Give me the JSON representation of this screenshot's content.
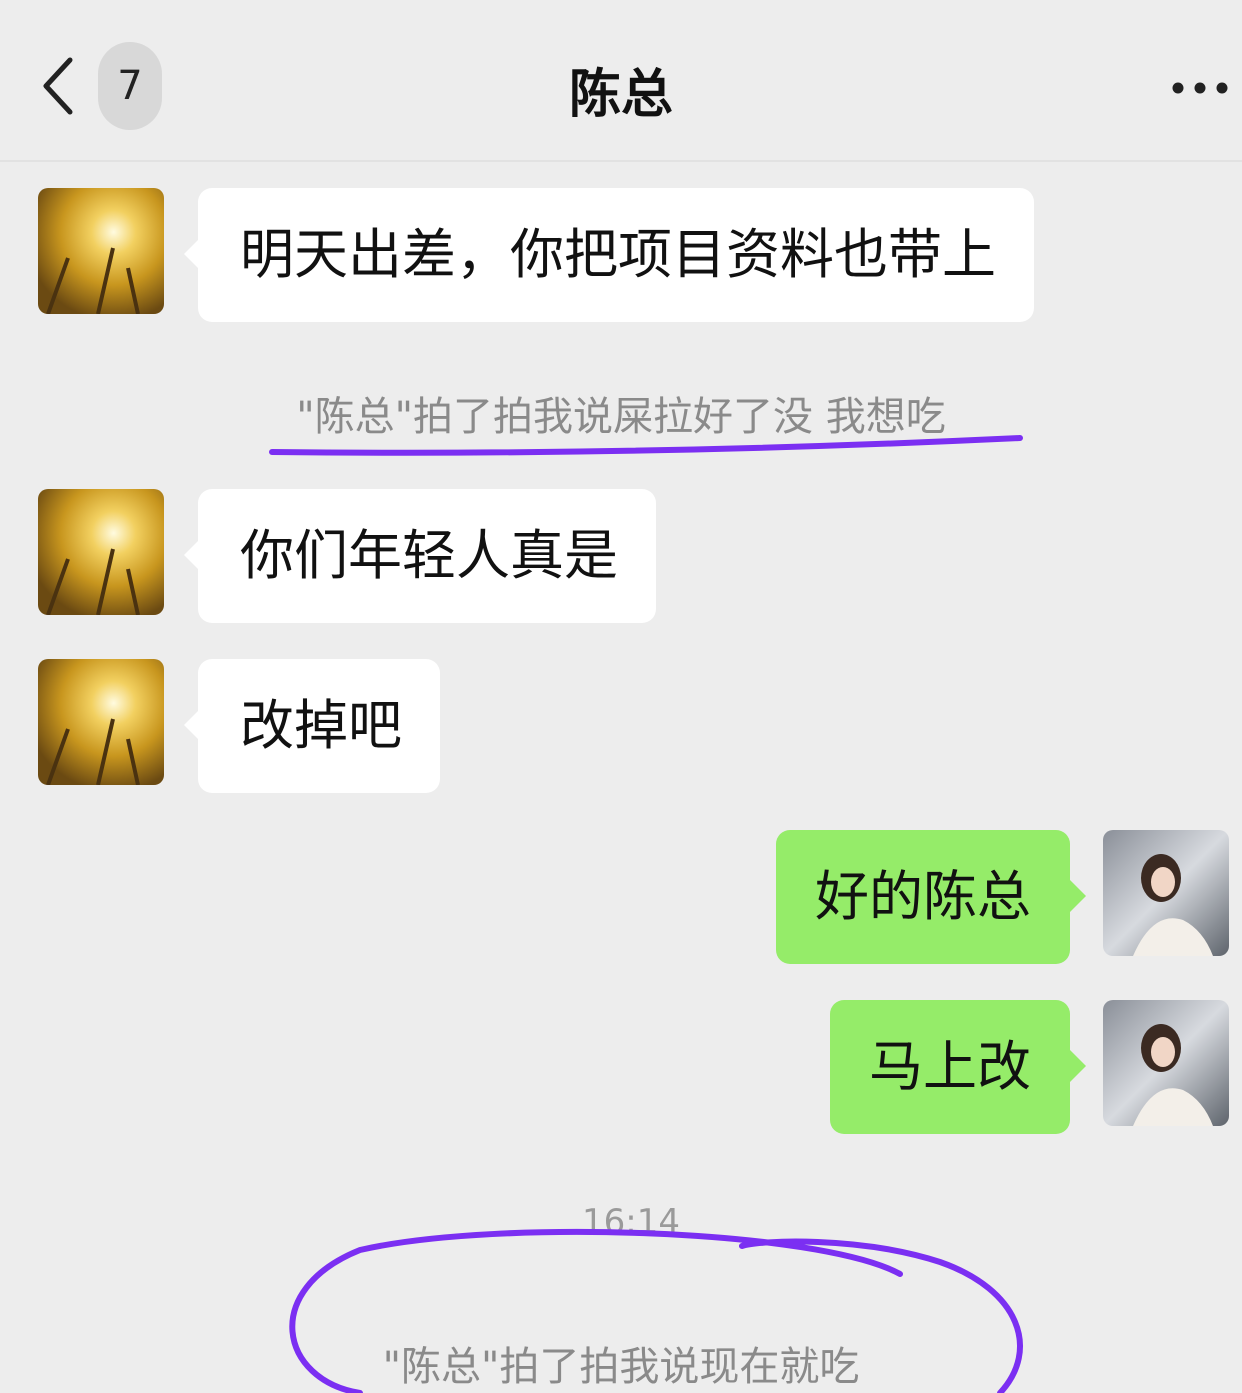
{
  "header": {
    "back_icon": "chevron-left-icon",
    "unread_count": "7",
    "title": "陈总",
    "more_icon": "ellipsis-icon"
  },
  "messages": [
    {
      "side": "left",
      "text": "明天出差，你把项目资料也带上"
    },
    {
      "side": "left",
      "text": "你们年轻人真是"
    },
    {
      "side": "left",
      "text": "改掉吧"
    },
    {
      "side": "right",
      "text": "好的陈总"
    },
    {
      "side": "right",
      "text": "马上改"
    }
  ],
  "system_notices": [
    "\"陈总\"拍了拍我说屎拉好了没  我想吃",
    "\"陈总\"拍了拍我说现在就吃"
  ],
  "timestamp": "16:14",
  "colors": {
    "background": "#ededed",
    "incoming_bubble": "#ffffff",
    "outgoing_bubble": "#95ec69",
    "annotation": "#7b2ff2"
  }
}
